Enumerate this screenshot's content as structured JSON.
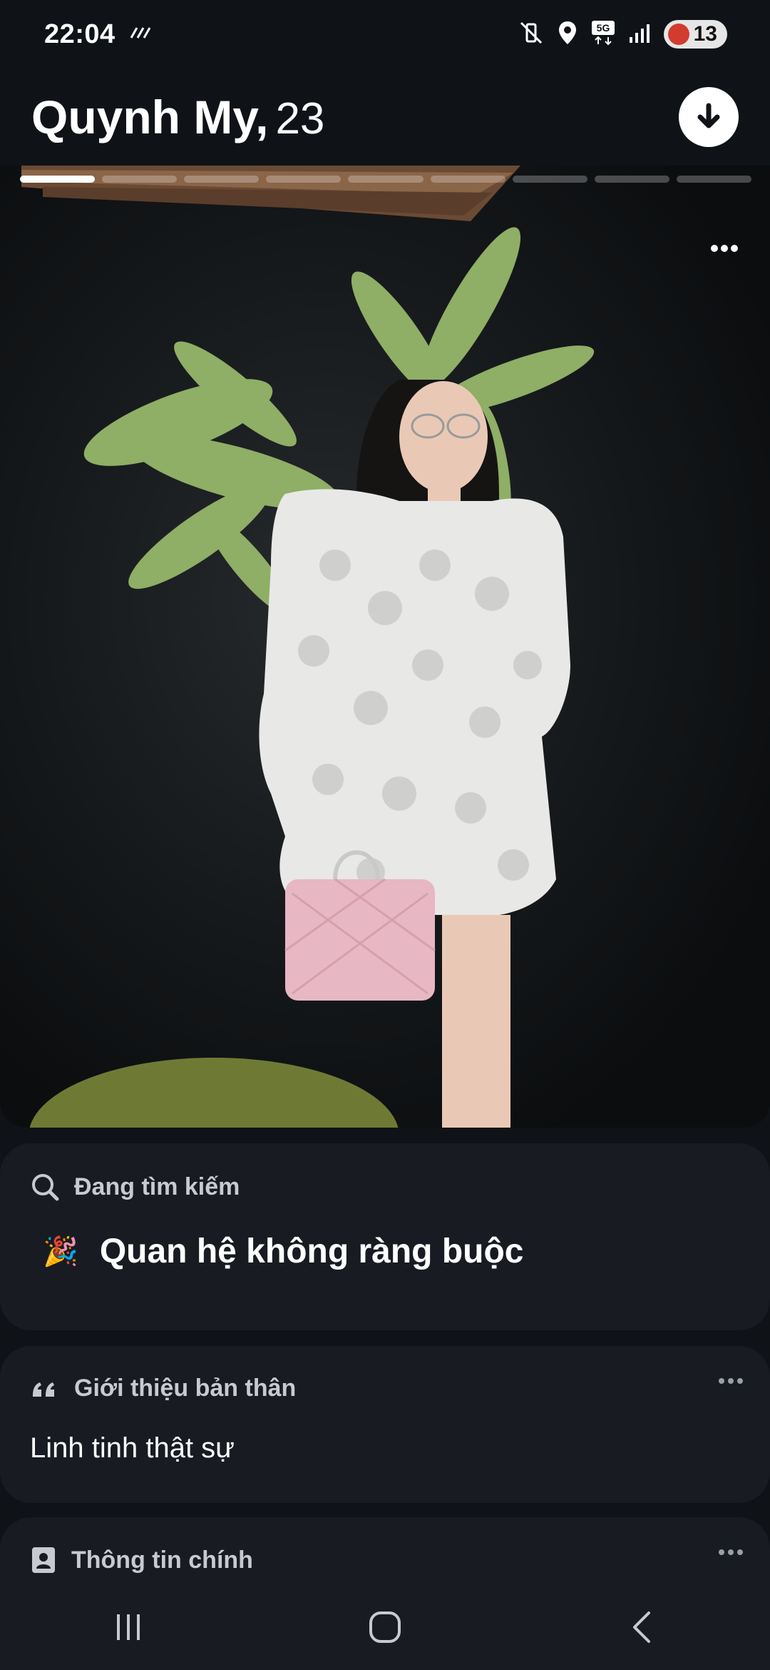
{
  "status_bar": {
    "time": "22:04",
    "battery_level": "13",
    "icons": [
      "stripes-icon",
      "mute-vibrate-icon",
      "location-icon",
      "5g-icon",
      "signal-icon",
      "battery-icon"
    ]
  },
  "profile": {
    "name": "Quynh My,",
    "age": "23",
    "photo_count": 9,
    "active_photo_index": 0
  },
  "looking_for": {
    "title": "Đang tìm kiếm",
    "emoji": "🎉",
    "value": "Quan hệ không ràng buộc"
  },
  "bio": {
    "title": "Giới thiệu bản thân",
    "text": "Linh tinh thật sự"
  },
  "basics": {
    "title": "Thông tin chính"
  },
  "colors": {
    "background": "#0f1318",
    "card": "#181c22",
    "muted_text": "#c7cbd1"
  }
}
